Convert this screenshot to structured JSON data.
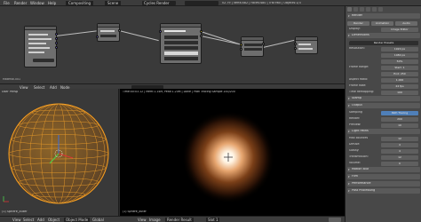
{
  "topbar": {
    "menus": [
      "File",
      "Render",
      "Window",
      "Help"
    ],
    "layout": "Compositing",
    "scene": "Scene",
    "engine": "Cycles Render",
    "stats": "v2.79 | Verts:482 | Faces:480 | Tris:960 | Objects:1/3"
  },
  "node_editor": {
    "material_label": "Material.001",
    "nodes": [
      {
        "id": "texcoord",
        "title": "Texture Coordinate"
      },
      {
        "id": "mapping",
        "title": "Mapping"
      },
      {
        "id": "tex",
        "title": "Gradient Texture"
      },
      {
        "id": "emission",
        "title": "Emission"
      },
      {
        "id": "output",
        "title": "Material Output"
      }
    ],
    "header_items": [
      "View",
      "Select",
      "Add",
      "Node"
    ]
  },
  "viewport": {
    "label": "User Persp",
    "object_label": "(1) Sphere_outer",
    "header_items": [
      "View",
      "Select",
      "Add",
      "Object",
      "Object Mode"
    ]
  },
  "render_view": {
    "info": "Time:00:03.12 | Mem:1.14M, Peak:1.20M | Done | Path Tracing Sample 200/200",
    "object_label": "(1) Sphere_outer",
    "header_items": [
      "View",
      "Image",
      "Render Result",
      "Slot 1"
    ]
  },
  "properties": {
    "sections": [
      {
        "title": "Render",
        "kind": "head"
      },
      {
        "title": "Render",
        "kind": "tri-buttons",
        "buttons": [
          "Render",
          "Animation",
          "Audio"
        ]
      },
      {
        "title": "Display:",
        "kind": "field",
        "value": "Image Editor"
      },
      {
        "title": "Dimensions",
        "kind": "head"
      },
      {
        "title": "Render Presets",
        "kind": "dark"
      },
      {
        "title": "Resolution:",
        "kind": "field",
        "value": "1920 px"
      },
      {
        "title": "",
        "kind": "field",
        "value": "1080 px"
      },
      {
        "title": "",
        "kind": "field",
        "value": "50%"
      },
      {
        "title": "Frame Range:",
        "kind": "field",
        "value": "Start: 1"
      },
      {
        "title": "",
        "kind": "field",
        "value": "End: 250"
      },
      {
        "title": "Aspect Ratio:",
        "kind": "field",
        "value": "1.000"
      },
      {
        "title": "Frame Rate:",
        "kind": "field",
        "value": "24 fps"
      },
      {
        "title": "Time Remapping:",
        "kind": "field",
        "value": "100"
      },
      {
        "title": "Stamp",
        "kind": "head"
      },
      {
        "title": "Output",
        "kind": "head"
      },
      {
        "title": "Sampling",
        "kind": "blue",
        "value": "Path Tracing"
      },
      {
        "title": "Render:",
        "kind": "field",
        "value": "200"
      },
      {
        "title": "Preview:",
        "kind": "field",
        "value": "10"
      },
      {
        "title": "Light Paths",
        "kind": "head"
      },
      {
        "title": "Max Bounces",
        "kind": "field",
        "value": "12"
      },
      {
        "title": "Diffuse:",
        "kind": "field",
        "value": "4"
      },
      {
        "title": "Glossy:",
        "kind": "field",
        "value": "4"
      },
      {
        "title": "Transmission:",
        "kind": "field",
        "value": "12"
      },
      {
        "title": "Volume:",
        "kind": "field",
        "value": "0"
      },
      {
        "title": "Motion Blur",
        "kind": "head"
      },
      {
        "title": "Film",
        "kind": "head"
      },
      {
        "title": "Performance",
        "kind": "head"
      },
      {
        "title": "Post Processing",
        "kind": "head"
      }
    ]
  },
  "bottombar": {
    "items": [
      "View",
      "Select",
      "Add",
      "Object",
      "Object Mode",
      "Global"
    ]
  }
}
